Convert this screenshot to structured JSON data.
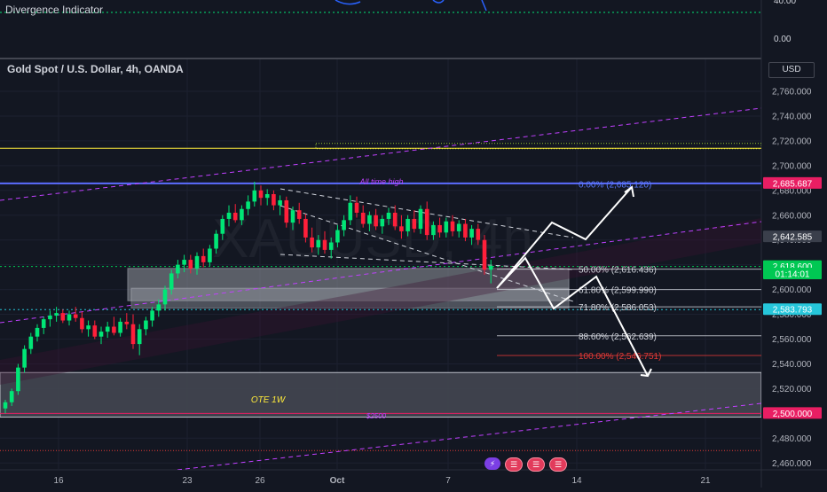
{
  "indicator": {
    "title": "Divergence Indicator",
    "ticks": [
      "40.00",
      "0.00"
    ]
  },
  "header": {
    "title": "Gold Spot / U.S. Dollar, 4h, OANDA",
    "currency_button": "USD"
  },
  "watermark": "XAUUSD, 4h",
  "chart_data": {
    "type": "candlestick",
    "title": "Gold Spot / U.S. Dollar, 4h, OANDA",
    "xlabel": "",
    "ylabel": "",
    "x_ticks": [
      "16",
      "23",
      "26",
      "Oct",
      "7",
      "14",
      "21"
    ],
    "y_ticks": [
      "2,760.000",
      "2,740.000",
      "2,720.000",
      "2,700.000",
      "2,680.000",
      "2,660.000",
      "2,640.000",
      "2,620.000",
      "2,600.000",
      "2,580.000",
      "2,560.000",
      "2,540.000",
      "2,520.000",
      "2,500.000",
      "2,480.000",
      "2,460.000"
    ],
    "ylim": [
      2455,
      2772
    ],
    "price_labels": [
      {
        "text": "2,685.687",
        "value": 2685.687,
        "color": "#e91e63"
      },
      {
        "text": "2,642.585",
        "value": 2642.585,
        "color": "#3a3f4b"
      },
      {
        "text": "2,618.600",
        "value": 2618.6,
        "color": "#00c853"
      },
      {
        "text": "01:14:01",
        "value": 2612.6,
        "color": "#00c853"
      },
      {
        "text": "2,583.793",
        "value": 2583.793,
        "color": "#26c6da"
      },
      {
        "text": "2,500.000",
        "value": 2500.0,
        "color": "#e91e63"
      }
    ],
    "fib_levels": [
      {
        "label": "0.00% (2,685.120)",
        "value": 2685.12,
        "color": "#5b7cff"
      },
      {
        "label": "50.00% (2,616.436)",
        "value": 2616.436,
        "color": "#d1d4dc"
      },
      {
        "label": "61.80% (2,599.990)",
        "value": 2599.99,
        "color": "#d1d4dc"
      },
      {
        "label": "71.80% (2,586.053)",
        "value": 2586.053,
        "color": "#d1d4dc"
      },
      {
        "label": "88.60% (2,562.639)",
        "value": 2562.639,
        "color": "#d1d4dc"
      },
      {
        "label": "100.00% (2,546.751)",
        "value": 2546.751,
        "color": "#e53935"
      }
    ],
    "annotations": [
      {
        "text": "All time high",
        "color": "#c040ff"
      },
      {
        "text": "OTE 1W",
        "color": "#ffeb3b"
      },
      {
        "text": "$2500",
        "color": "#c040ff"
      }
    ],
    "candles": [
      [
        2504,
        2511,
        2500,
        2509
      ],
      [
        2509,
        2520,
        2506,
        2518
      ],
      [
        2518,
        2540,
        2515,
        2537
      ],
      [
        2537,
        2555,
        2533,
        2552
      ],
      [
        2552,
        2565,
        2548,
        2562
      ],
      [
        2562,
        2572,
        2558,
        2569
      ],
      [
        2569,
        2578,
        2564,
        2576
      ],
      [
        2576,
        2583,
        2570,
        2579
      ],
      [
        2579,
        2586,
        2574,
        2581
      ],
      [
        2581,
        2584,
        2573,
        2575
      ],
      [
        2575,
        2583,
        2571,
        2580
      ],
      [
        2580,
        2586,
        2574,
        2577
      ],
      [
        2577,
        2582,
        2565,
        2568
      ],
      [
        2568,
        2575,
        2562,
        2571
      ],
      [
        2571,
        2575,
        2560,
        2562
      ],
      [
        2562,
        2570,
        2556,
        2566
      ],
      [
        2566,
        2574,
        2561,
        2570
      ],
      [
        2570,
        2578,
        2563,
        2565
      ],
      [
        2565,
        2577,
        2562,
        2574
      ],
      [
        2574,
        2581,
        2568,
        2572
      ],
      [
        2572,
        2580,
        2552,
        2556
      ],
      [
        2556,
        2572,
        2547,
        2568
      ],
      [
        2568,
        2578,
        2563,
        2575
      ],
      [
        2575,
        2586,
        2570,
        2583
      ],
      [
        2583,
        2592,
        2578,
        2588
      ],
      [
        2588,
        2603,
        2583,
        2600
      ],
      [
        2600,
        2616,
        2596,
        2613
      ],
      [
        2613,
        2624,
        2609,
        2620
      ],
      [
        2620,
        2628,
        2614,
        2624
      ],
      [
        2624,
        2628,
        2613,
        2617
      ],
      [
        2617,
        2630,
        2612,
        2627
      ],
      [
        2627,
        2633,
        2618,
        2622
      ],
      [
        2622,
        2636,
        2619,
        2633
      ],
      [
        2633,
        2648,
        2629,
        2645
      ],
      [
        2645,
        2660,
        2640,
        2657
      ],
      [
        2657,
        2668,
        2651,
        2662
      ],
      [
        2662,
        2669,
        2654,
        2656
      ],
      [
        2656,
        2668,
        2652,
        2665
      ],
      [
        2665,
        2676,
        2660,
        2671
      ],
      [
        2671,
        2687,
        2667,
        2680
      ],
      [
        2680,
        2684,
        2668,
        2674
      ],
      [
        2674,
        2681,
        2668,
        2677
      ],
      [
        2677,
        2680,
        2664,
        2668
      ],
      [
        2668,
        2676,
        2660,
        2672
      ],
      [
        2672,
        2675,
        2650,
        2654
      ],
      [
        2654,
        2667,
        2648,
        2664
      ],
      [
        2664,
        2670,
        2653,
        2657
      ],
      [
        2657,
        2661,
        2638,
        2642
      ],
      [
        2642,
        2650,
        2630,
        2634
      ],
      [
        2634,
        2644,
        2628,
        2640
      ],
      [
        2640,
        2647,
        2629,
        2632
      ],
      [
        2632,
        2642,
        2625,
        2638
      ],
      [
        2638,
        2652,
        2634,
        2648
      ],
      [
        2648,
        2660,
        2643,
        2656
      ],
      [
        2656,
        2676,
        2652,
        2670
      ],
      [
        2670,
        2675,
        2658,
        2662
      ],
      [
        2662,
        2668,
        2650,
        2653
      ],
      [
        2653,
        2663,
        2647,
        2660
      ],
      [
        2660,
        2665,
        2648,
        2651
      ],
      [
        2651,
        2660,
        2645,
        2657
      ],
      [
        2657,
        2666,
        2652,
        2662
      ],
      [
        2662,
        2668,
        2648,
        2651
      ],
      [
        2651,
        2660,
        2641,
        2647
      ],
      [
        2647,
        2660,
        2643,
        2657
      ],
      [
        2657,
        2664,
        2646,
        2649
      ],
      [
        2649,
        2668,
        2645,
        2665
      ],
      [
        2665,
        2671,
        2640,
        2644
      ],
      [
        2644,
        2655,
        2640,
        2652
      ],
      [
        2652,
        2658,
        2642,
        2646
      ],
      [
        2646,
        2658,
        2642,
        2655
      ],
      [
        2655,
        2660,
        2643,
        2647
      ],
      [
        2647,
        2656,
        2642,
        2653
      ],
      [
        2653,
        2657,
        2639,
        2642
      ],
      [
        2642,
        2652,
        2636,
        2649
      ],
      [
        2649,
        2653,
        2636,
        2640
      ],
      [
        2640,
        2644,
        2612,
        2616
      ],
      [
        2616,
        2624,
        2605,
        2619
      ]
    ]
  }
}
